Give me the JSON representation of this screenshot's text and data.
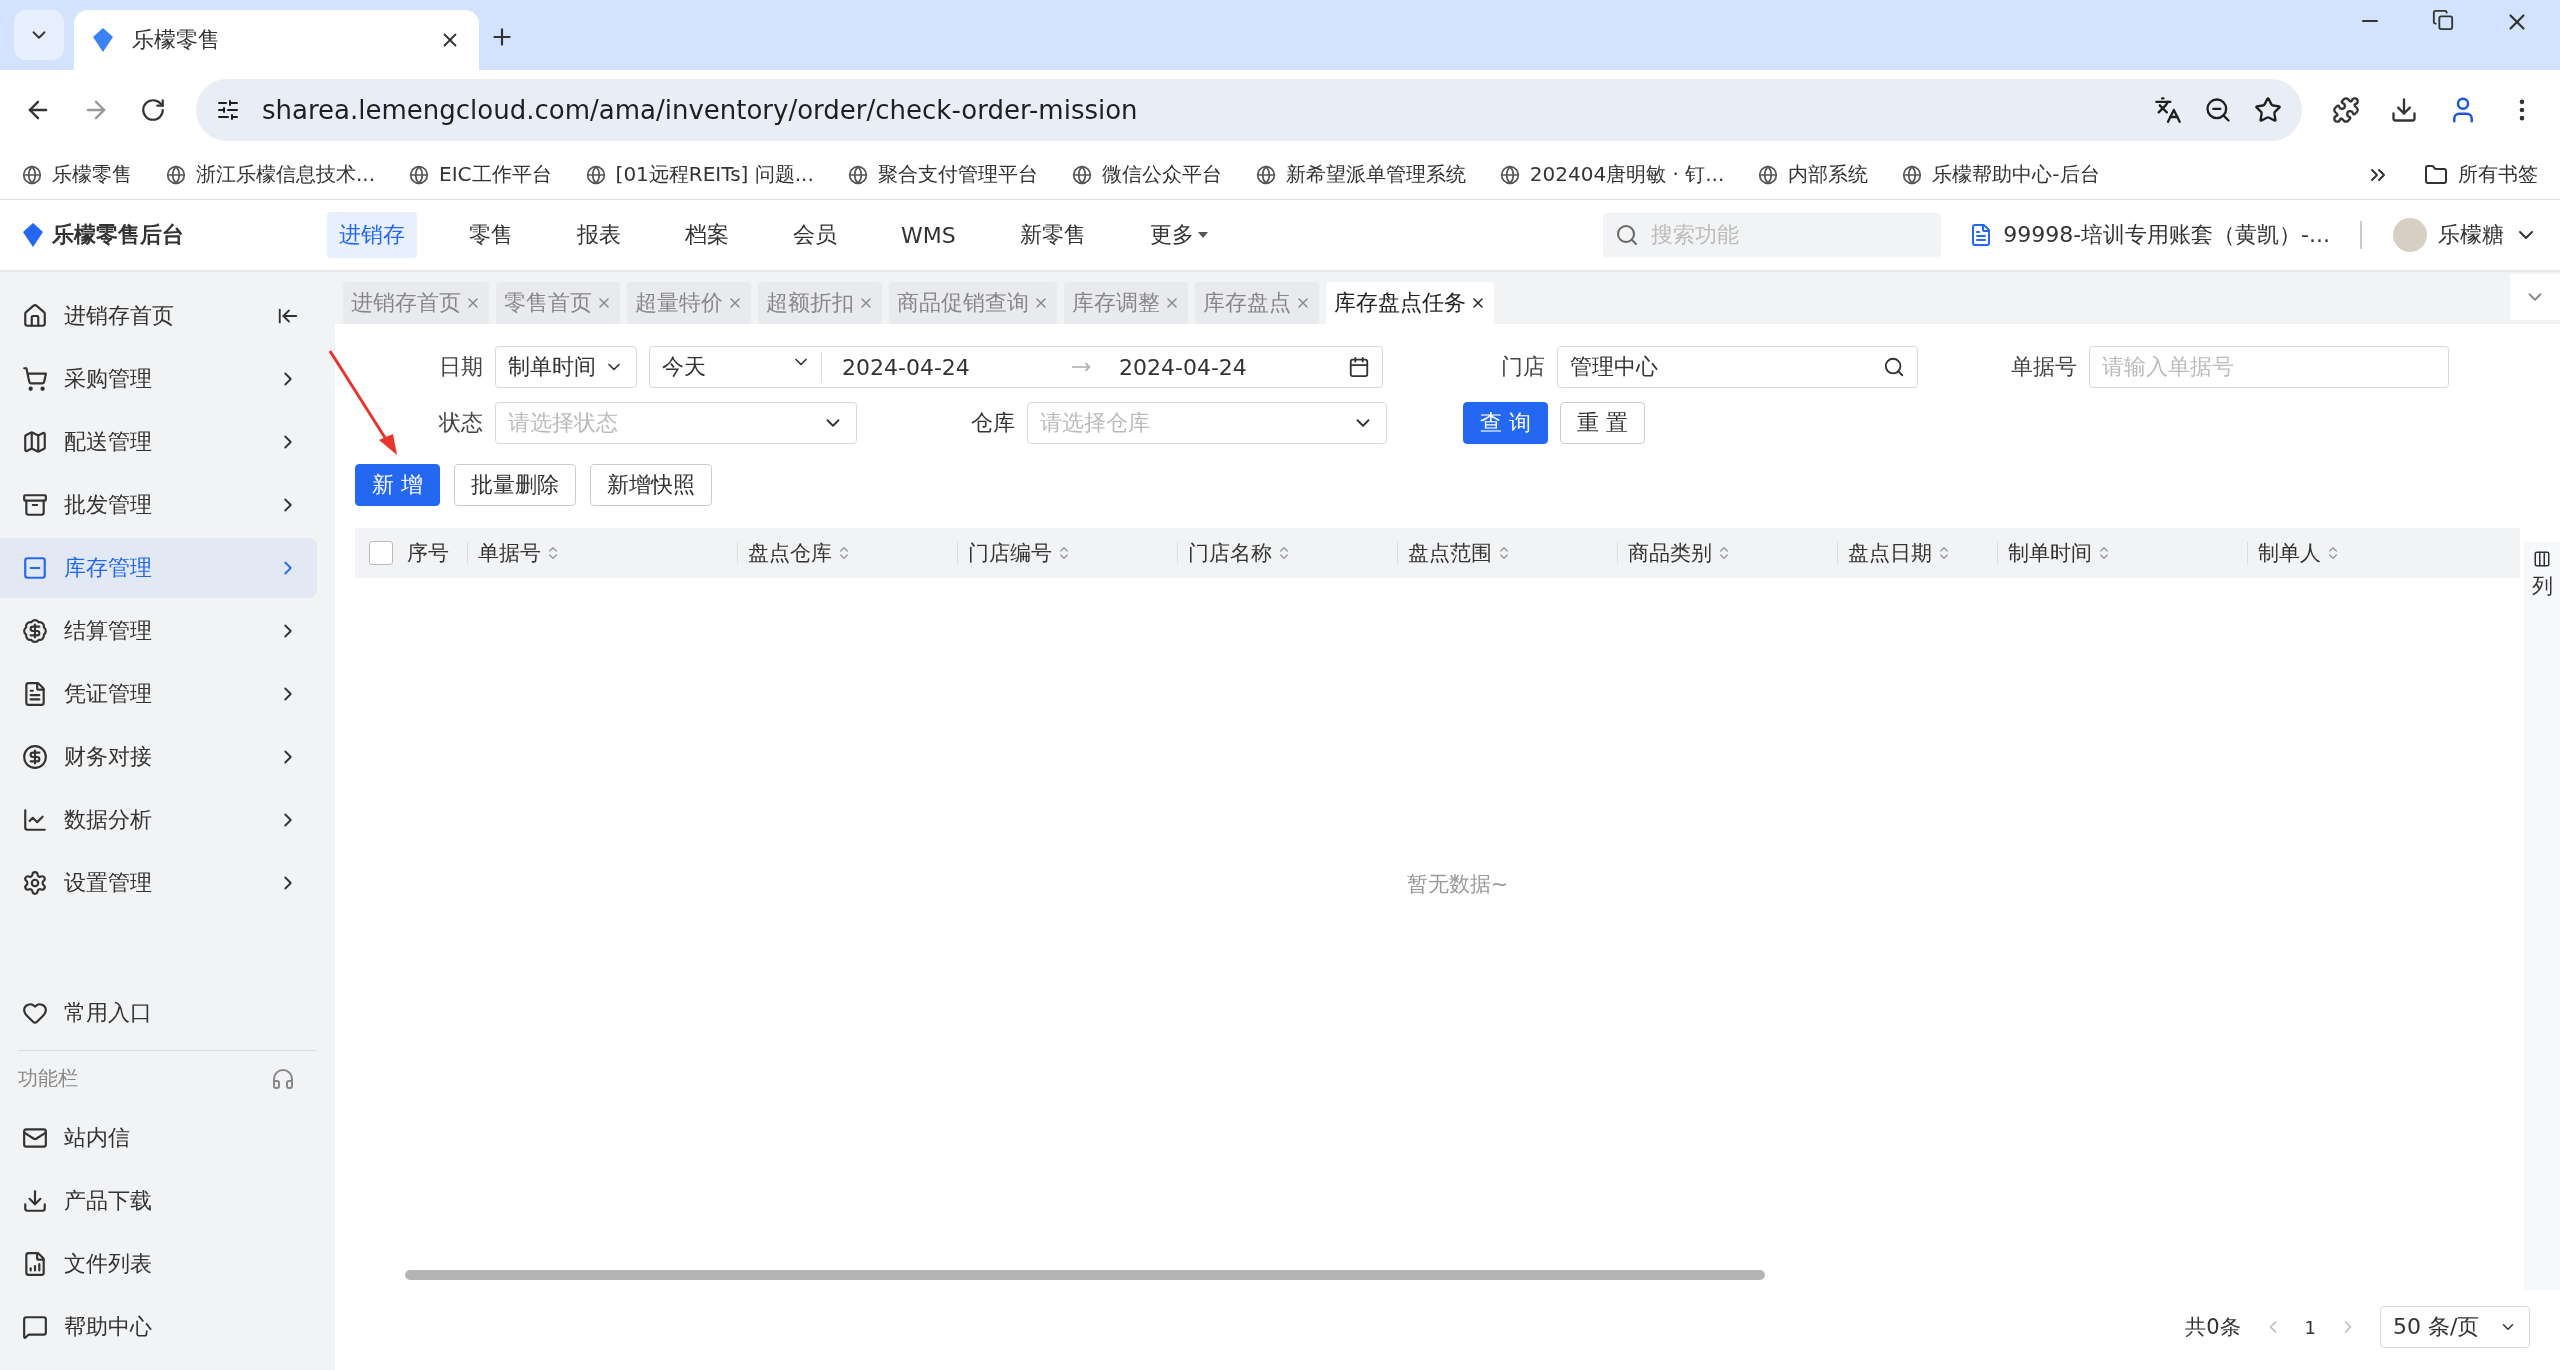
{
  "browser": {
    "tabs": [
      {
        "title": "乐檬零售",
        "selected": true
      }
    ],
    "url": "sharea.lemengcloud.com/ama/inventory/order/check-order-mission",
    "bookmarks": [
      "乐檬零售",
      "浙江乐檬信息技术...",
      "EIC工作平台",
      "[01远程REITs] 问题...",
      "聚合支付管理平台",
      "微信公众平台",
      "新希望派单管理系统",
      "202404唐明敏 · 钉...",
      "内部系统",
      "乐檬帮助中心-后台"
    ],
    "all_bookmarks": "所有书签"
  },
  "header": {
    "logo": "乐檬零售后台",
    "nav": [
      {
        "label": "进销存",
        "selected": true
      },
      {
        "label": "零售",
        "selected": false
      },
      {
        "label": "报表",
        "selected": false
      },
      {
        "label": "档案",
        "selected": false
      },
      {
        "label": "会员",
        "selected": false
      },
      {
        "label": "WMS",
        "selected": false
      },
      {
        "label": "新零售",
        "selected": false
      },
      {
        "label": "更多",
        "selected": false
      }
    ],
    "search": {
      "placeholder": "搜索功能"
    },
    "account": "99998-培训专用账套（黄凯）-...",
    "user": "乐檬糖"
  },
  "sidebar": {
    "items": [
      {
        "label": "进销存首页",
        "selected": false
      },
      {
        "label": "采购管理",
        "selected": false
      },
      {
        "label": "配送管理",
        "selected": false
      },
      {
        "label": "批发管理",
        "selected": false
      },
      {
        "label": "库存管理",
        "selected": true
      },
      {
        "label": "结算管理",
        "selected": false
      },
      {
        "label": "凭证管理",
        "selected": false
      },
      {
        "label": "财务对接",
        "selected": false
      },
      {
        "label": "数据分析",
        "selected": false
      },
      {
        "label": "设置管理",
        "selected": false
      }
    ],
    "favorites": "常用入口",
    "section": "功能栏",
    "tools": [
      "站内信",
      "产品下载",
      "文件列表",
      "帮助中心"
    ]
  },
  "page_tabs": [
    {
      "label": "进销存首页",
      "selected": false
    },
    {
      "label": "零售首页",
      "selected": false
    },
    {
      "label": "超量特价",
      "selected": false
    },
    {
      "label": "超额折扣",
      "selected": false
    },
    {
      "label": "商品促销查询",
      "selected": false
    },
    {
      "label": "库存调整",
      "selected": false
    },
    {
      "label": "库存盘点",
      "selected": false
    },
    {
      "label": "库存盘点任务",
      "selected": true
    }
  ],
  "filters": {
    "date_label": "日期",
    "date_type": "制单时间",
    "date_range": "今天",
    "date_from": "2024-04-24",
    "date_to": "2024-04-24",
    "store_label": "门店",
    "store": "管理中心",
    "order_label": "单据号",
    "order_placeholder": "请输入单据号",
    "status_label": "状态",
    "status_placeholder": "请选择状态",
    "warehouse_label": "仓库",
    "warehouse_placeholder": "请选择仓库",
    "query": "查 询",
    "reset": "重 置"
  },
  "actions": [
    "新 增",
    "批量删除",
    "新增快照"
  ],
  "table": {
    "columns": [
      "序号",
      "单据号",
      "盘点仓库",
      "门店编号",
      "门店名称",
      "盘点范围",
      "商品类别",
      "盘点日期",
      "制单时间",
      "制单人"
    ],
    "checked": false,
    "empty": "暂无数据~",
    "column_settings": "列"
  },
  "pagination": {
    "total": "共0条",
    "page": "1",
    "page_size": "50 条/页"
  }
}
